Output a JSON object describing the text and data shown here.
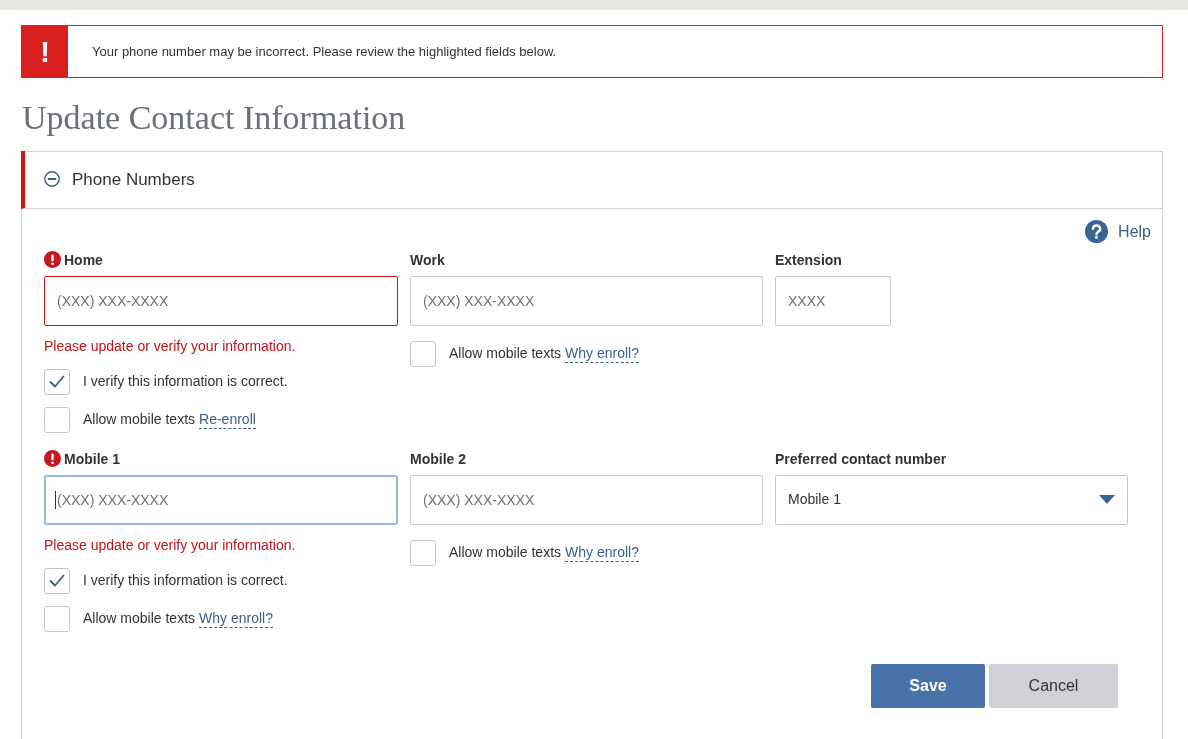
{
  "alert": {
    "symbol": "!",
    "message": "Your phone number may be incorrect. Please review the highlighted fields below."
  },
  "page_title": "Update Contact Information",
  "section": {
    "title": "Phone Numbers",
    "expanded": true,
    "help": "Help",
    "rows": [
      [
        {
          "kind": "phone",
          "label": "Home",
          "error": true,
          "focused": false,
          "placeholder": "(XXX) XXX-XXXX",
          "error_message": "Please update or verify your information.",
          "options": [
            {
              "label": "I verify this information is correct.",
              "checked": true
            },
            {
              "label": "Allow mobile texts",
              "link": "Re-enroll",
              "checked": false
            }
          ]
        },
        {
          "kind": "phone",
          "label": "Work",
          "error": false,
          "focused": false,
          "placeholder": "(XXX) XXX-XXXX",
          "options": [
            {
              "label": "Allow mobile texts",
              "link": "Why enroll?",
              "checked": false
            }
          ]
        },
        {
          "kind": "extension",
          "label": "Extension",
          "error": false,
          "focused": false,
          "placeholder": "XXXX"
        }
      ],
      [
        {
          "kind": "phone",
          "label": "Mobile 1",
          "error": true,
          "focused": true,
          "placeholder": "(XXX) XXX-XXXX",
          "error_message": "Please update or verify your information.",
          "options": [
            {
              "label": "I verify this information is correct.",
              "checked": true
            },
            {
              "label": "Allow mobile texts",
              "link": "Why enroll?",
              "checked": false
            }
          ]
        },
        {
          "kind": "phone",
          "label": "Mobile 2",
          "error": false,
          "focused": false,
          "placeholder": "(XXX) XXX-XXXX",
          "options": [
            {
              "label": "Allow mobile texts",
              "link": "Why enroll?",
              "checked": false
            }
          ]
        },
        {
          "kind": "select",
          "label": "Preferred contact number",
          "error": false,
          "focused": false,
          "value": "Mobile 1"
        }
      ]
    ]
  },
  "buttons": [
    {
      "kind": "primary",
      "label": "Save"
    },
    {
      "kind": "secondary",
      "label": "Cancel"
    }
  ]
}
